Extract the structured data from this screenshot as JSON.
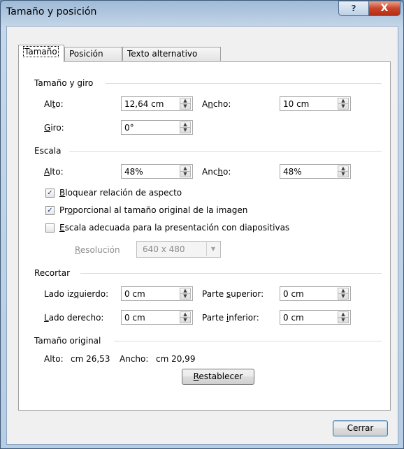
{
  "window": {
    "title": "Tamaño y posición",
    "help_label": "?",
    "close_label": "X"
  },
  "tabs": [
    {
      "label": "Tamaño",
      "active": true
    },
    {
      "label": "Posición",
      "active": false
    },
    {
      "label": "Texto alternativo",
      "active": false
    }
  ],
  "size_rotation": {
    "heading": "Tamaño y giro",
    "height_label_pre": "Al",
    "height_label_u": "t",
    "height_label_post": "o:",
    "height_value": "12,64 cm",
    "width_label_pre": "A",
    "width_label_u": "n",
    "width_label_post": "cho:",
    "width_value": "10 cm",
    "rotation_label_pre": "",
    "rotation_label_u": "G",
    "rotation_label_post": "iro:",
    "rotation_value": "0°"
  },
  "scale": {
    "heading": "Escala",
    "height_label_pre": "",
    "height_label_u": "A",
    "height_label_post": "lto:",
    "height_value": "48%",
    "width_label_pre": "Anc",
    "width_label_u": "h",
    "width_label_post": "o:",
    "width_value": "48%",
    "lock_aspect": {
      "pre": "",
      "u": "B",
      "post": "loquear relación de aspecto",
      "checked": true
    },
    "relative_original": {
      "pre": "Pr",
      "u": "o",
      "post": "porcional al tamaño original de la imagen",
      "checked": true
    },
    "best_scale": {
      "pre": "",
      "u": "E",
      "post": "scala adecuada para la presentación con diapositivas",
      "checked": false
    },
    "resolution_label_pre": "",
    "resolution_label_u": "R",
    "resolution_label_post": "esolución",
    "resolution_value": "640 x 480"
  },
  "crop": {
    "heading": "Recortar",
    "left_pre": "Lado iz",
    "left_u": "q",
    "left_post": "uierdo:",
    "left_value": "0 cm",
    "top_pre": "Parte ",
    "top_u": "s",
    "top_post": "uperior:",
    "top_value": "0 cm",
    "right_pre": "",
    "right_u": "L",
    "right_post": "ado derecho:",
    "right_value": "0 cm",
    "bottom_pre": "Parte ",
    "bottom_u": "i",
    "bottom_post": "nferior:",
    "bottom_value": "0 cm"
  },
  "original_size": {
    "heading": "Tamaño original",
    "height_label": "Alto:",
    "height_value": "cm 26,53",
    "width_label": "Ancho:",
    "width_value": "cm 20,99",
    "reset_pre": "",
    "reset_u": "R",
    "reset_post": "establecer"
  },
  "footer": {
    "close_button": "Cerrar"
  },
  "icons": {
    "spin_up": "▲",
    "spin_down": "▼",
    "checkmark": "✓",
    "dropdown": "▼"
  }
}
